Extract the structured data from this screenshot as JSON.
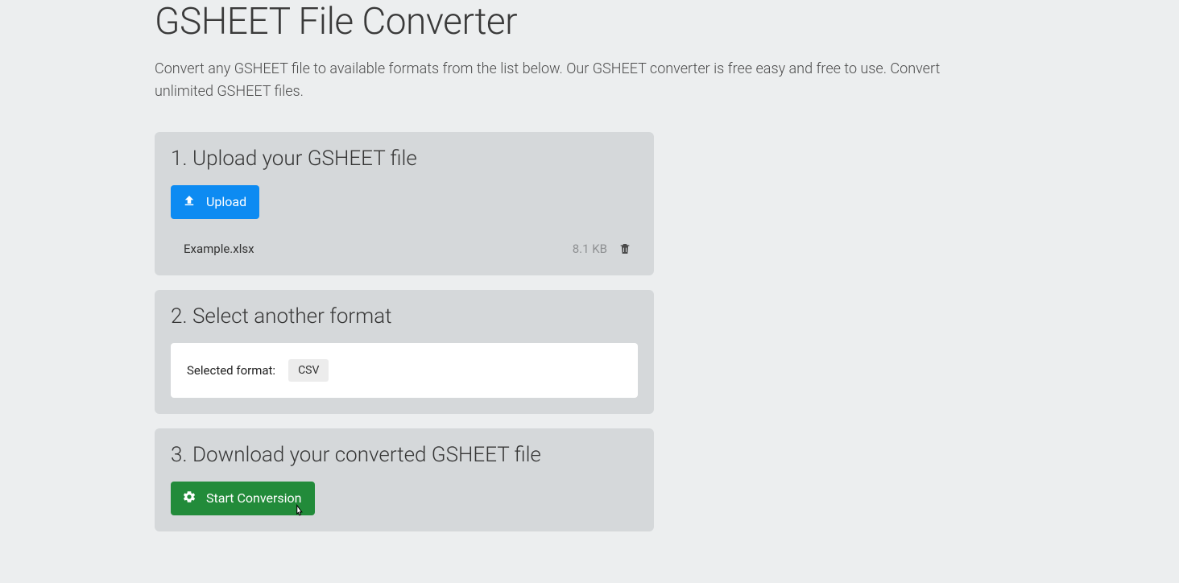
{
  "header": {
    "title": "GSHEET File Converter",
    "description": "Convert any GSHEET file to available formats from the list below. Our GSHEET converter is free easy and free to use. Convert unlimited GSHEET files."
  },
  "step1": {
    "title": "1. Upload your GSHEET file",
    "upload_label": "Upload",
    "file": {
      "name": "Example.xlsx",
      "size": "8.1 KB"
    }
  },
  "step2": {
    "title": "2. Select another format",
    "label": "Selected format:",
    "selected": "CSV"
  },
  "step3": {
    "title": "3. Download your converted GSHEET file",
    "button_label": "Start Conversion"
  }
}
